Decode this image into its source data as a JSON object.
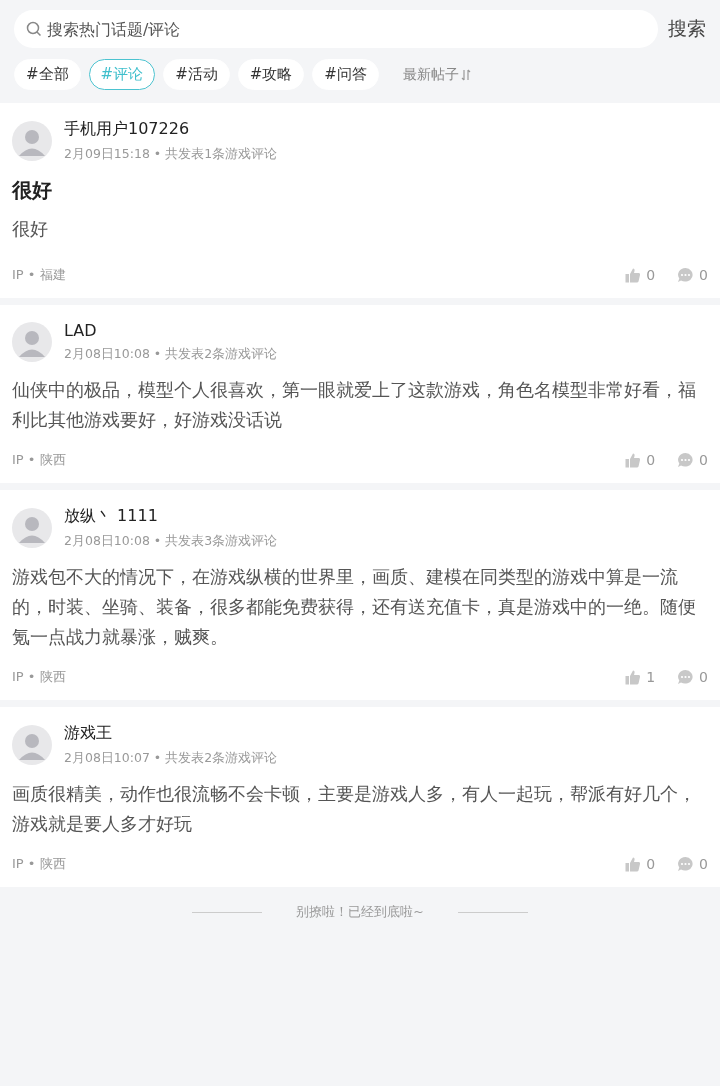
{
  "search": {
    "placeholder": "搜索热门话题/评论",
    "button": "搜索"
  },
  "filters": [
    {
      "label": "#全部",
      "selected": false
    },
    {
      "label": "#评论",
      "selected": true
    },
    {
      "label": "#活动",
      "selected": false
    },
    {
      "label": "#攻略",
      "selected": false
    },
    {
      "label": "#问答",
      "selected": false
    }
  ],
  "sort": {
    "label": "最新帖子"
  },
  "posts": [
    {
      "user": "手机用户107226",
      "meta": "2月09日15:18 • 共发表1条游戏评论",
      "title": "很好",
      "content": "很好",
      "location": "IP • 福建",
      "likes": "0",
      "comments": "0"
    },
    {
      "user": "LAD",
      "meta": "2月08日10:08 • 共发表2条游戏评论",
      "content": "仙侠中的极品，模型个人很喜欢，第一眼就爱上了这款游戏，角色名模型非常好看，福利比其他游戏要好，好游戏没话说",
      "location": "IP • 陕西",
      "likes": "0",
      "comments": "0"
    },
    {
      "user": "放纵丶 1111",
      "meta": "2月08日10:08 • 共发表3条游戏评论",
      "content": "游戏包不大的情况下，在游戏纵横的世界里，画质、建模在同类型的游戏中算是一流的，时装、坐骑、装备，很多都能免费获得，还有送充值卡，真是游戏中的一绝。随便氪一点战力就暴涨，贼爽。",
      "location": "IP • 陕西",
      "likes": "1",
      "comments": "0"
    },
    {
      "user": "游戏王",
      "meta": "2月08日10:07 • 共发表2条游戏评论",
      "content": "画质很精美，动作也很流畅不会卡顿，主要是游戏人多，有人一起玩，帮派有好几个，游戏就是要人多才好玩",
      "location": "IP • 陕西",
      "likes": "0",
      "comments": "0"
    }
  ],
  "end_note": "别撩啦！已经到底啦~"
}
